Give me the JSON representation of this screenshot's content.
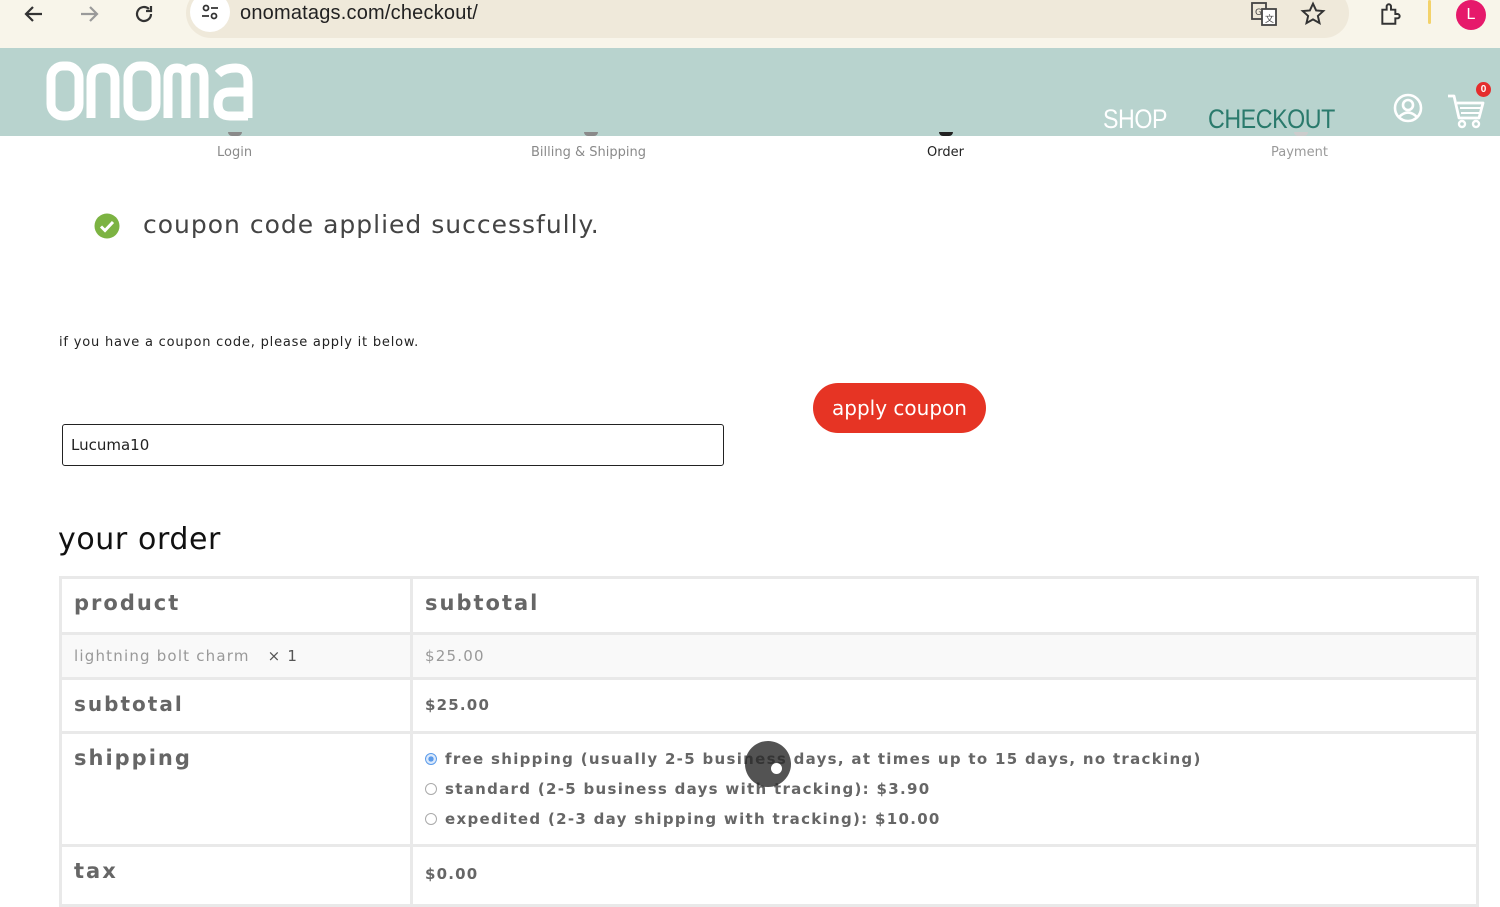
{
  "browser": {
    "url": "onomatags.com/checkout/",
    "profile_initial": "L"
  },
  "header": {
    "logo_text": "onoma",
    "menu": {
      "shop": "SHOP",
      "checkout": "CHECKOUT"
    },
    "cart_count": "0"
  },
  "steps": [
    "Login",
    "Billing & Shipping",
    "Order",
    "Payment"
  ],
  "notice": {
    "message": "coupon code applied successfully."
  },
  "coupon": {
    "hint": "if you have a coupon code, please apply it below.",
    "value": "Lucuma10",
    "button_label": "apply coupon"
  },
  "order": {
    "title": "your order",
    "headers": {
      "product": "product",
      "subtotal": "subtotal"
    },
    "item": {
      "name": "lightning bolt charm",
      "qty": "× 1",
      "price": "$25.00"
    },
    "subtotal": {
      "label": "subtotal",
      "value": "$25.00"
    },
    "shipping": {
      "label": "shipping",
      "options": [
        {
          "label": "free shipping (usually 2-5 business days, at times up to 15 days, no tracking)",
          "selected": true
        },
        {
          "label": "standard (2-5 business days with tracking): $3.90",
          "selected": false
        },
        {
          "label": "expedited (2-3 day shipping with tracking): $10.00",
          "selected": false
        }
      ]
    },
    "tax": {
      "label": "tax",
      "value": "$0.00"
    }
  },
  "colors": {
    "header_bg": "#b8d3ce",
    "checkout_link": "#2a7a6c",
    "apply_button": "#e63424",
    "success_check": "#7cb342"
  }
}
